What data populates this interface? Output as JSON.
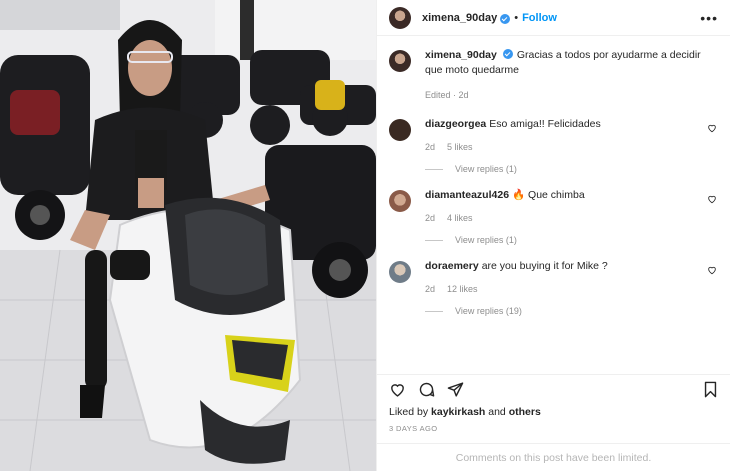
{
  "post": {
    "username": "ximena_90day",
    "follow_label": "Follow",
    "separator": "•",
    "more_label": "•••"
  },
  "caption": {
    "username": "ximena_90day",
    "text": "Gracias a todos por ayudarme a decidir que moto quedarme",
    "meta": "Edited · 2d"
  },
  "comments": [
    {
      "username": "diazgeorgea",
      "text": "Eso amiga!! Felicidades",
      "age": "2d",
      "likes": "5 likes",
      "replies": "View replies (1)",
      "avatar_color": "#3a2a22"
    },
    {
      "username": "diamanteazul426",
      "emoji": "🔥",
      "text": "Que chimba",
      "age": "2d",
      "likes": "4 likes",
      "replies": "View replies (1)",
      "avatar_color": "#8a5a48"
    },
    {
      "username": "doraemery",
      "text": "are you buying it for Mike ?",
      "age": "2d",
      "likes": "12 likes",
      "replies": "View replies (19)",
      "avatar_color": "#6f7c88"
    }
  ],
  "footer": {
    "liked_prefix": "Liked by",
    "liked_user": "kaykirkash",
    "liked_and": "and",
    "liked_others": "others",
    "time_ago": "3 DAYS AGO",
    "comments_limited": "Comments on this post have been limited."
  },
  "colors": {
    "accent": "#0095f6",
    "verified": "#3897f0",
    "muted": "#8e8e8e"
  }
}
